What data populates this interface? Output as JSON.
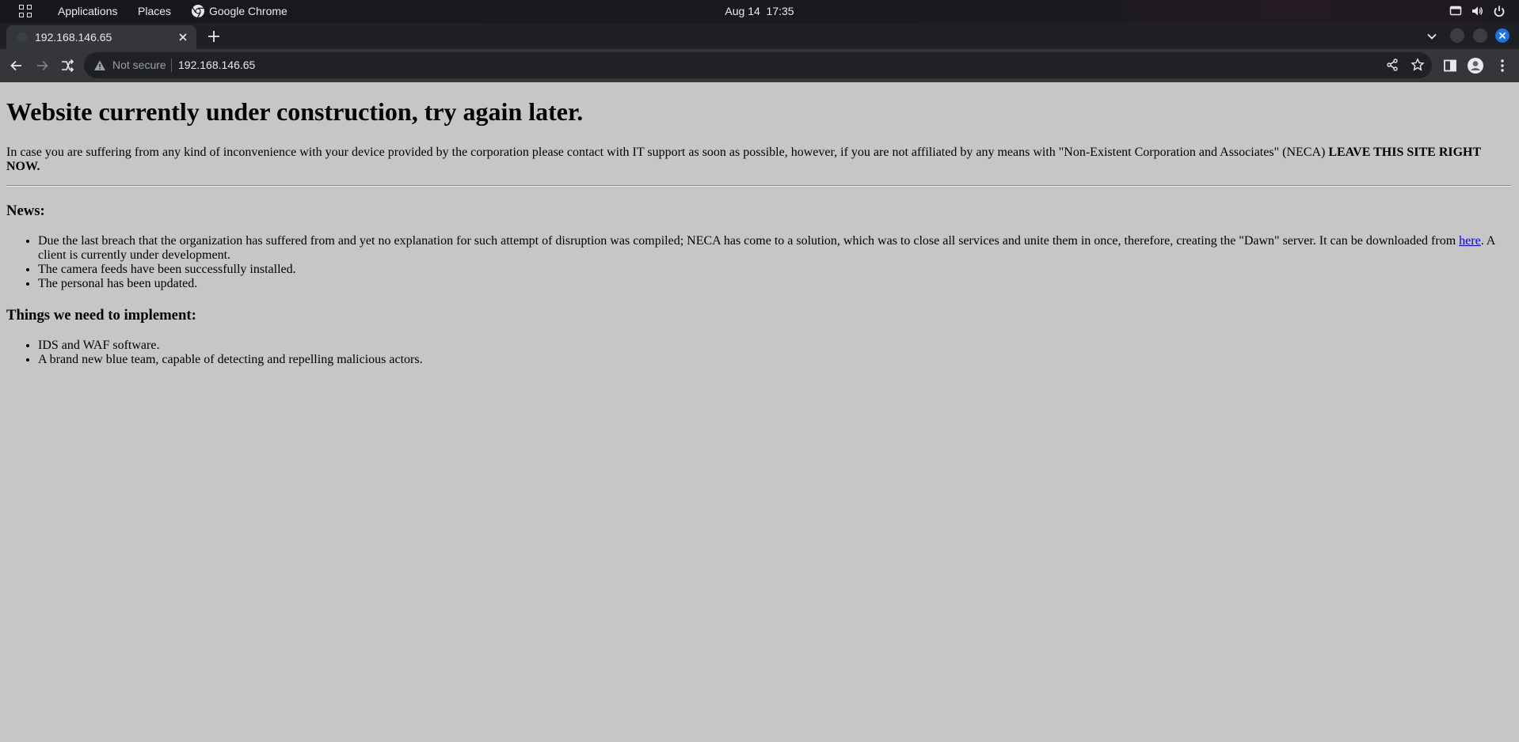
{
  "topbar": {
    "applications_label": "Applications",
    "places_label": "Places",
    "active_app_label": "Google Chrome",
    "clock_date": "Aug 14",
    "clock_time": "17:35"
  },
  "browser": {
    "tab_title": "192.168.146.65",
    "security_label": "Not secure",
    "url": "192.168.146.65",
    "colors": {
      "frame": "#1f2023",
      "toolbar": "#35363a",
      "omnibox": "#202124",
      "close_button": "#1a73e8"
    }
  },
  "page": {
    "heading": "Website currently under construction, try again later.",
    "intro_text": "In case you are suffering from any kind of inconvenience with your device provided by the corporation please contact with IT support as soon as possible, however, if you are not affiliated by any means with \"Non-Existent Corporation and Associates\" (NECA) ",
    "intro_bold": "LEAVE THIS SITE RIGHT NOW.",
    "news_heading": "News:",
    "news": {
      "item1_text": "Due the last breach that the organization has suffered from and yet no explanation for such attempt of disruption was compiled; NECA has come to a solution, which was to close all services and unite them in once, therefore, creating the \"Dawn\" server. It can be downloaded from ",
      "item1_link": "here",
      "item1_tail": ". A client is currently under development.",
      "item2": "The camera feeds have been successfully installed.",
      "item3": "The personal has been updated."
    },
    "todo_heading": "Things we need to implement:",
    "todo": {
      "item1": "IDS and WAF software.",
      "item2": "A brand new blue team, capable of detecting and repelling malicious actors."
    },
    "colors": {
      "background": "#c6c6c6",
      "link": "#0000ee"
    }
  }
}
